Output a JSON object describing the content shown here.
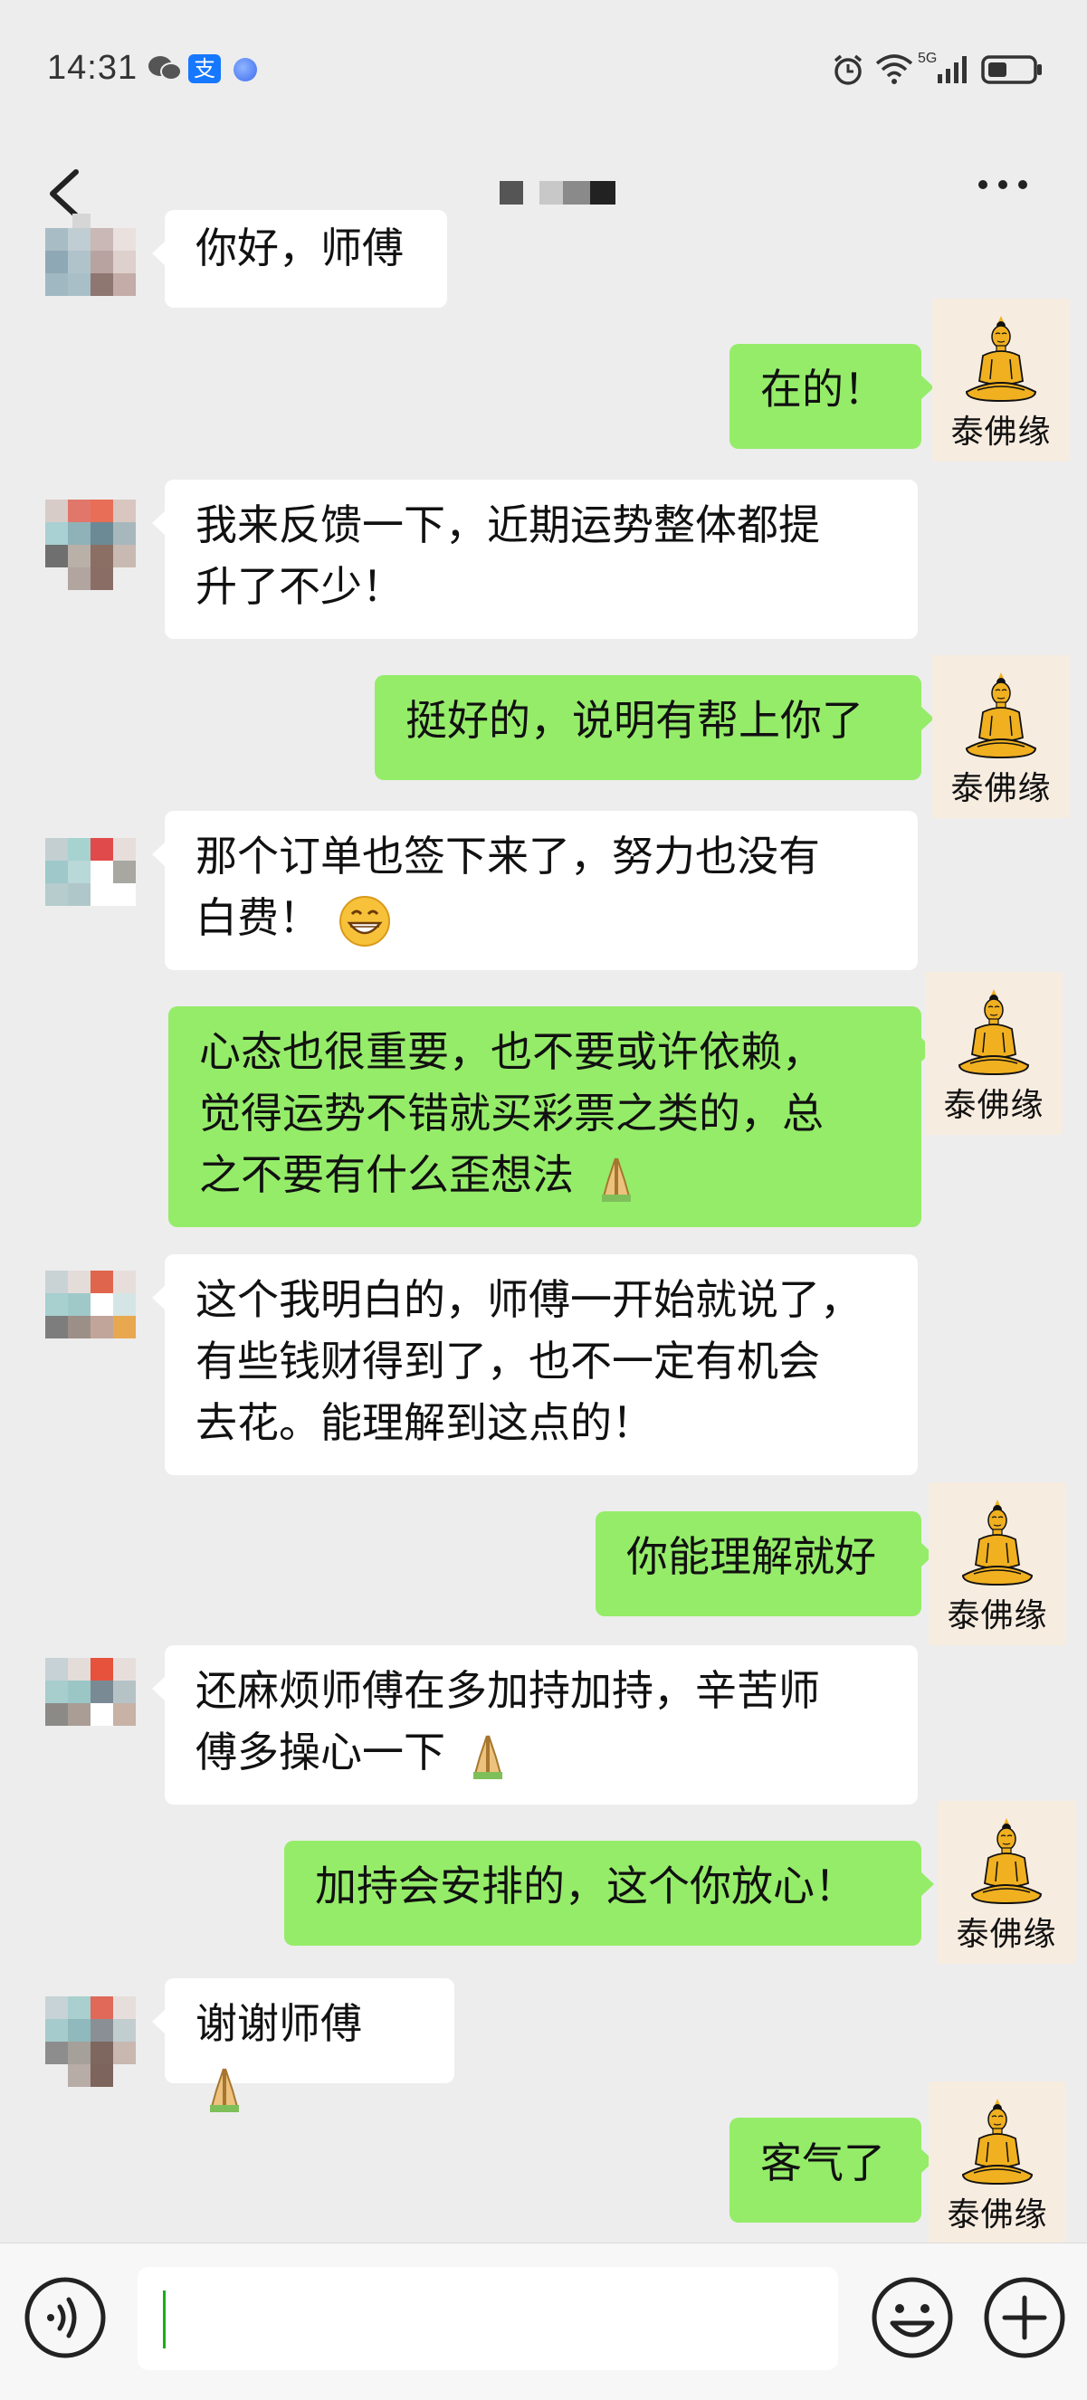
{
  "status_bar": {
    "time": "14:31",
    "network": "5G",
    "icons": [
      "wechat-icon",
      "alipay-icon",
      "blue-dot-icon",
      "alarm-icon",
      "wifi-icon",
      "signal-icon",
      "battery-icon"
    ],
    "alipay_glyph": "支"
  },
  "header": {
    "back_icon": "back-arrow-icon",
    "title": "",
    "more_icon": "more-dots-icon"
  },
  "brand_avatar_text": "泰佛缘",
  "messages": [
    {
      "side": "in",
      "text": "你好，师傅"
    },
    {
      "side": "out",
      "text": "在的！"
    },
    {
      "side": "in",
      "line1": "我来反馈一下，近期运势整体都提",
      "line2": "升了不少！"
    },
    {
      "side": "out",
      "text": "挺好的，说明有帮上你了"
    },
    {
      "side": "in",
      "line1": "那个订单也签下来了，努力也没有",
      "line2": "白费！",
      "emoji": "grin-icon"
    },
    {
      "side": "out",
      "line1": "心态也很重要，也不要或许依赖，",
      "line2": "觉得运势不错就买彩票之类的，总",
      "line3": "之不要有什么歪想法",
      "emoji": "pray-icon"
    },
    {
      "side": "in",
      "line1": "这个我明白的，师傅一开始就说了，",
      "line2": "有些钱财得到了，也不一定有机会",
      "line3": "去花。能理解到这点的！"
    },
    {
      "side": "out",
      "text": "你能理解就好"
    },
    {
      "side": "in",
      "line1": "还麻烦师傅在多加持加持，辛苦师",
      "line2": "傅多操心一下",
      "emoji": "pray-icon"
    },
    {
      "side": "out",
      "text": "加持会安排的，这个你放心！"
    },
    {
      "side": "in",
      "text": "谢谢师傅",
      "emoji": "pray-icon"
    },
    {
      "side": "out",
      "text": "客气了"
    }
  ],
  "input_bar": {
    "placeholder": "",
    "voice_icon": "voice-icon",
    "emoji_icon": "emoji-face-icon",
    "plus_icon": "plus-icon"
  },
  "colors": {
    "background": "#ededed",
    "incoming_bubble": "#ffffff",
    "outgoing_bubble": "#95ec69",
    "avatar_bg": "#f7ece0",
    "buddha_gold": "#f0b020"
  }
}
